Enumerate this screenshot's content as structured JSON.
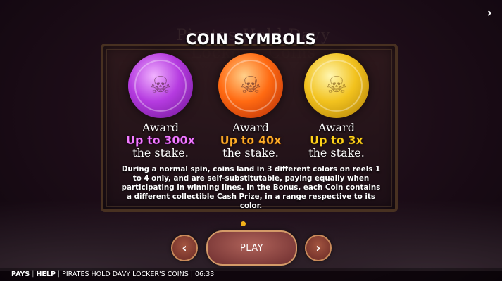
{
  "background": {
    "logo_text": "Pirates Hold Davy Locker's Coins"
  },
  "title": "COIN SYMBOLS",
  "coins": [
    {
      "color": "purple",
      "icon": "skull-icon",
      "award": "Award",
      "amount": "Up to 300x",
      "stake": "the stake."
    },
    {
      "color": "orange",
      "icon": "skull-icon",
      "award": "Award",
      "amount": "Up to 40x",
      "stake": "the stake."
    },
    {
      "color": "gold",
      "icon": "skull-icon",
      "award": "Award",
      "amount": "Up to 3x",
      "stake": "the stake."
    }
  ],
  "description": "During a normal spin, coins land in 3 different colors on reels 1 to 4 only, and are self-substitutable, paying equally when participating in winning lines. In the Bonus, each Coin contains a different collectible Cash Prize, in a range respective to its color.",
  "pager": {
    "prev_icon": "‹",
    "next_icon": "›",
    "play_label": "PLAY",
    "top_next_icon": "›"
  },
  "footer": {
    "pays": "PAYS",
    "help": "HELP",
    "game_name": "PIRATES HOLD DAVY LOCKER'S COINS",
    "time": "06:33"
  },
  "colors": {
    "accent_dot": "#f2b21a",
    "purple": "#f27dff",
    "orange": "#ffb12a",
    "gold": "#ffd21a"
  }
}
